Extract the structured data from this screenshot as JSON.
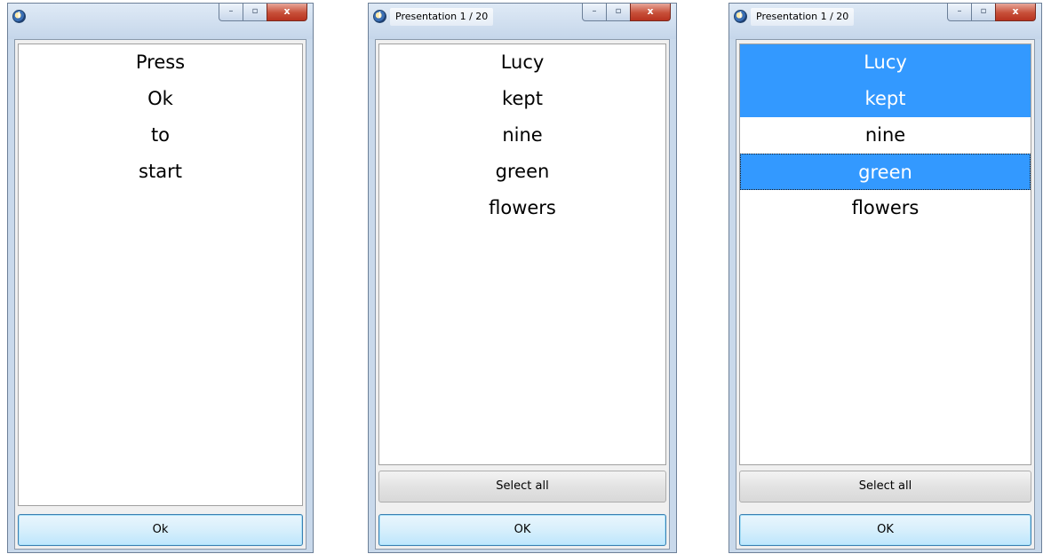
{
  "windows": [
    {
      "title": "",
      "controls": {
        "minimize": "–",
        "maximize": "▫",
        "close": "x"
      },
      "items": [
        "Press",
        "Ok",
        "to",
        "start"
      ],
      "ok_label": "Ok"
    },
    {
      "title": "Presentation 1 / 20",
      "controls": {
        "minimize": "–",
        "maximize": "▫",
        "close": "x"
      },
      "items": [
        "Lucy",
        "kept",
        "nine",
        "green",
        "flowers"
      ],
      "select_all_label": "Select all",
      "ok_label": "OK"
    },
    {
      "title": "Presentation 1 / 20",
      "controls": {
        "minimize": "–",
        "maximize": "▫",
        "close": "x"
      },
      "items": [
        "Lucy",
        "kept",
        "nine",
        "green",
        "flowers"
      ],
      "selected": [
        "Lucy",
        "kept",
        "green"
      ],
      "focused": "green",
      "select_all_label": "Select all",
      "ok_label": "OK"
    }
  ],
  "colors": {
    "selection": "#3399ff",
    "window_frame": "#c9d9eb",
    "close_button": "#c75039"
  },
  "icons": {
    "app_icon": "info-icon"
  }
}
